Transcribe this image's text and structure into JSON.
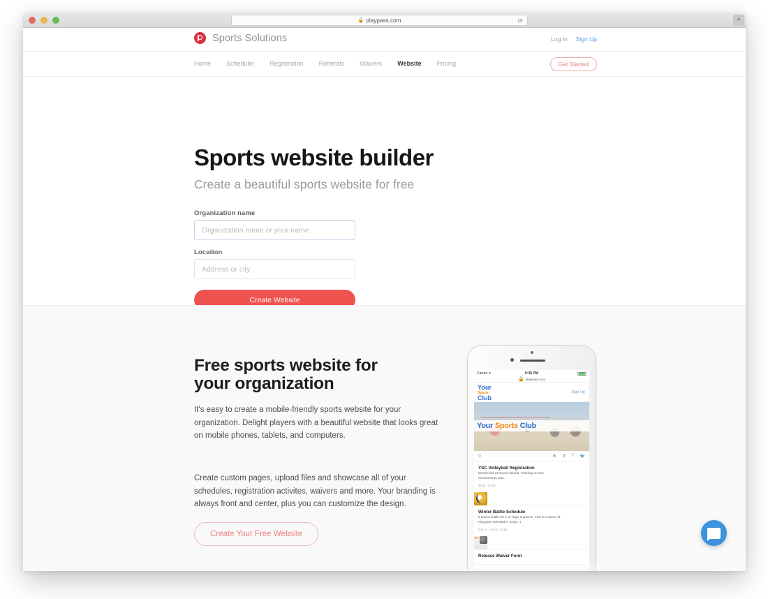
{
  "browser": {
    "url": "playpass.com",
    "lock_icon": "lock-icon",
    "reload_icon": "reload-icon",
    "new_tab_label": "+",
    "traffic_lights": [
      "close",
      "minimize",
      "zoom"
    ]
  },
  "header": {
    "brand_name": "Sports Solutions",
    "logo_icon": "playpass-p-logo-icon",
    "login_label": "Log In",
    "signup_label": "Sign Up"
  },
  "nav": {
    "items": [
      {
        "label": "Home",
        "active": false
      },
      {
        "label": "Scheduler",
        "active": false
      },
      {
        "label": "Registration",
        "active": false
      },
      {
        "label": "Referrals",
        "active": false
      },
      {
        "label": "Waivers",
        "active": false
      },
      {
        "label": "Website",
        "active": true
      },
      {
        "label": "Pricing",
        "active": false
      }
    ],
    "cta_label": "Get Started"
  },
  "hero": {
    "title": "Sports website builder",
    "subtitle": "Create a beautiful sports website for free",
    "org_label": "Organization name",
    "org_placeholder": "Organization name or your name",
    "org_value": "",
    "location_label": "Location",
    "location_placeholder": "Address or city",
    "location_value": "",
    "submit_label": "Create Website"
  },
  "section_two": {
    "title": "Free sports website for your organization",
    "paragraph_1": "It's easy to create a mobile-friendly sports website for your organization. Delight players with a beautiful website that looks great on mobile phones, tablets, and computers.",
    "paragraph_2": "Create custom pages, upload files and showcase all of your schedules, registration activites, waivers and more. Your branding is always front and center, plus you can customize the design.",
    "cta_label": "Create Your Free Website"
  },
  "phone": {
    "status": {
      "carrier": "Carrier",
      "time": "6:45 PM",
      "wifi_icon": "wifi-icon",
      "battery_icon": "battery-icon"
    },
    "url": "playpass.com",
    "logo": {
      "line1": "Your",
      "line2": "Sports",
      "line3": "Club"
    },
    "signup_label": "Sign Up",
    "banner": {
      "word1": "Your",
      "word2": "Sports",
      "word3": "Club"
    },
    "search_icon": "search-icon",
    "social_icons": [
      "mail-icon",
      "phone-icon",
      "facebook-icon",
      "twitter-icon"
    ],
    "items": [
      {
        "title": "YSC Volleyball Registration",
        "desc": "Weekends at Ocean Beach. Training on Sat, tournaments Sun.",
        "meta": "$100 - $750",
        "thumb": "volleyball-icon"
      },
      {
        "title": "Winter Battle Schedule",
        "desc": "6 teams battle for 1 to reign supreme. This is a demo of Playpass Scheduler. Enjoy :)",
        "meta": "Dec 2 – Jan 4, 2019",
        "thumb": "battle-icon"
      },
      {
        "title": "Release Waiver Form",
        "desc": "",
        "meta": "",
        "thumb": ""
      }
    ]
  },
  "chat": {
    "icon": "chat-bubble-icon"
  },
  "colors": {
    "accent_red": "#ef5350",
    "brand_red": "#d9323f",
    "link_blue": "#5b9fe0",
    "chat_blue": "#3c93dd",
    "section_bg": "#f9f9f9"
  }
}
